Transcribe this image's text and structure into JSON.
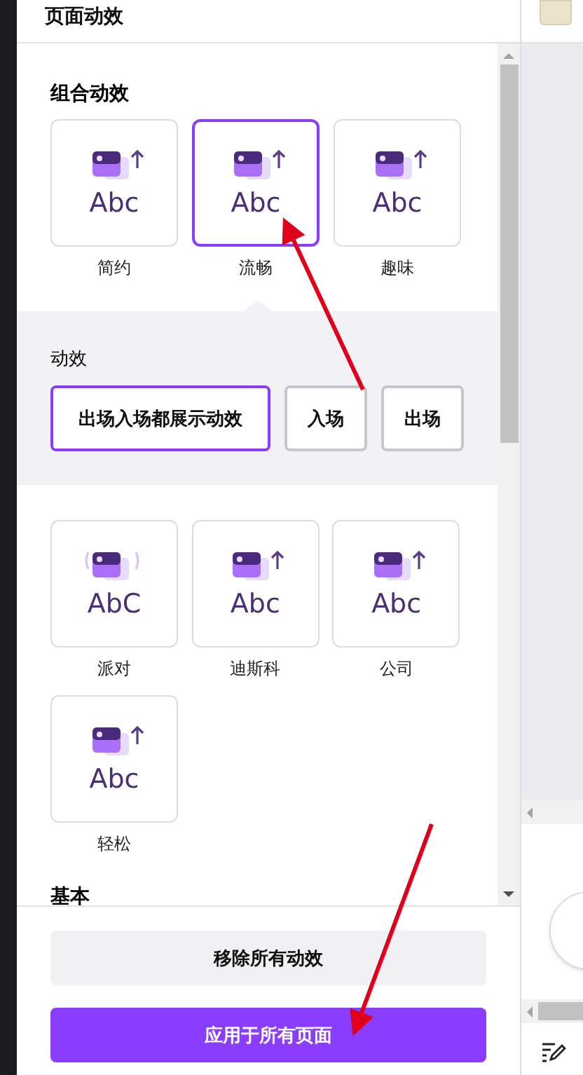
{
  "panel": {
    "title": "页面动效"
  },
  "combo": {
    "heading": "组合动效",
    "cards": [
      {
        "label": "简约",
        "preview": "Abc",
        "selected": false
      },
      {
        "label": "流畅",
        "preview": "Abc",
        "selected": true
      },
      {
        "label": "趣味",
        "preview": "Abc",
        "selected": false
      }
    ]
  },
  "effect": {
    "heading": "动效",
    "options": [
      {
        "label": "出场入场都展示动效",
        "selected": true
      },
      {
        "label": "入场",
        "selected": false
      },
      {
        "label": "出场",
        "selected": false
      }
    ]
  },
  "styles": [
    {
      "label": "派对",
      "preview": "AbC"
    },
    {
      "label": "迪斯科",
      "preview": "Abc"
    },
    {
      "label": "公司",
      "preview": "Abc"
    },
    {
      "label": "轻松",
      "preview": "Abc"
    }
  ],
  "basic_heading": "基本",
  "buttons": [
    {
      "label": "移除所有动效",
      "kind": "secondary"
    },
    {
      "label": "应用于所有页面",
      "kind": "primary"
    }
  ]
}
